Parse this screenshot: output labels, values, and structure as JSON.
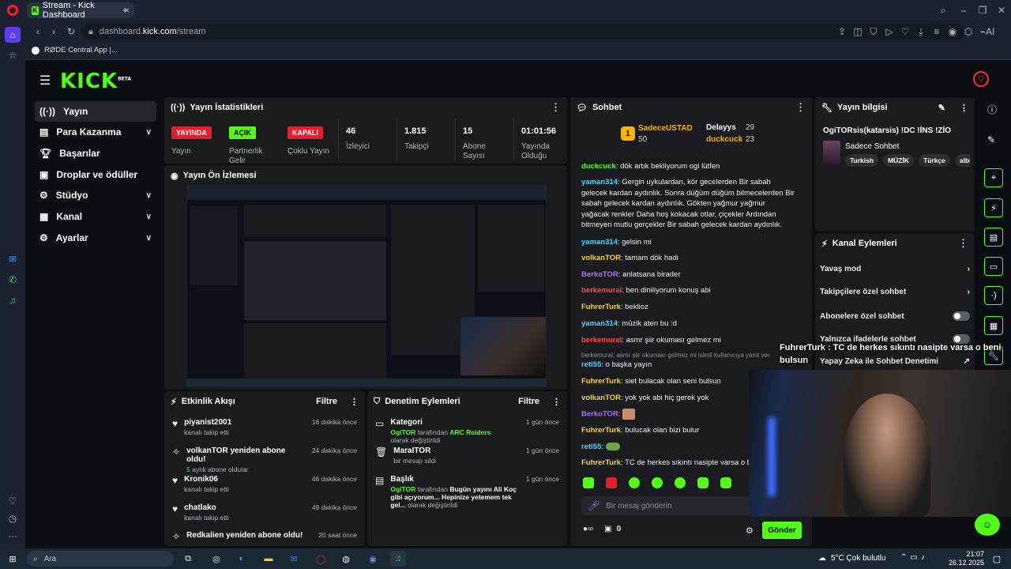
{
  "browser": {
    "tab_title": "Stream - Kick Dashboard",
    "url_prefix": "dashboard.",
    "url_host": "kick.com",
    "url_path": "/stream",
    "bookmark": "RØDE Central App |..."
  },
  "logo": {
    "text": "KICK",
    "beta": "BETA"
  },
  "nav": [
    {
      "label": "Yayın",
      "icon": "broadcast-icon"
    },
    {
      "label": "Para Kazanma",
      "icon": "wallet-icon"
    },
    {
      "label": "Başarılar",
      "icon": "trophy-icon"
    },
    {
      "label": "Droplar ve ödüller",
      "icon": "gift-icon"
    },
    {
      "label": "Stüdyo",
      "icon": "gear-icon"
    },
    {
      "label": "Kanal",
      "icon": "channel-icon"
    },
    {
      "label": "Ayarlar",
      "icon": "settings-icon"
    }
  ],
  "stats": {
    "title": "Yayın İstatistikleri",
    "live_badge": "YAYINDA",
    "live_label": "Yayın",
    "partner_badge": "AÇIK",
    "partner_label": "Partnerlik Gelir",
    "multi_badge": "KAPALI",
    "multi_label": "Çoklu Yayın",
    "viewers_value": "46",
    "viewers_label": "İzleyici",
    "followers_value": "1.815",
    "followers_label": "Takipçi",
    "subs_value": "15",
    "subs_label": "Abone Sayısı",
    "uptime_value": "01:01:56",
    "uptime_label": "Yayında Olduğu"
  },
  "preview": {
    "title": "Yayın Ön İzlemesi"
  },
  "activity": {
    "title": "Etkinlik Akışı",
    "filter": "Filtre",
    "items": [
      {
        "title": "piyanist2001",
        "sub": "kanalı takip etti",
        "time": "16 dakika önce",
        "icon": "heart-icon"
      },
      {
        "title": "volkanTOR yeniden abone oldu!",
        "sub_num": "5",
        "sub": "aylık abone oldular",
        "time": "24 dakika önce",
        "icon": "sparkle-icon"
      },
      {
        "title": "Kronik06",
        "sub": "kanalı takip etti",
        "time": "46 dakika önce",
        "icon": "heart-icon"
      },
      {
        "title": "chatlako",
        "sub": "kanalı takip etti",
        "time": "49 dakika önce",
        "icon": "heart-icon"
      },
      {
        "title": "Redkalien yeniden abone oldu!",
        "sub": "",
        "time": "20 saat önce",
        "icon": "sparkle-icon"
      }
    ]
  },
  "moderation": {
    "title": "Denetim Eylemleri",
    "filter": "Filtre",
    "items": [
      {
        "title": "Kategori",
        "user": "OgiTOR",
        "mid": "tarafından",
        "value": "ARC Raiders",
        "tail": "olarak değiştirildi",
        "time": "1 gün önce"
      },
      {
        "title": "MaraITOR",
        "user": "",
        "mid": "bir mesajı sildi",
        "value": "",
        "tail": "",
        "time": "1 gün önce"
      },
      {
        "title": "Başlık",
        "user": "OgiTOR",
        "mid": "tarafından",
        "value": "Bugün yayını Ali Koç gibi açıyorum... Hepinize yetemem tek gel...",
        "tail": "olarak değiştirildi",
        "time": "1 gün önce"
      }
    ]
  },
  "chat": {
    "title": "Sohbet",
    "top1_name": "SadeceUSTAD",
    "top1_score": "50",
    "top2_name": "Delayys",
    "top2_score": "29",
    "top3_name": "duckcuck",
    "top3_score": "23",
    "messages": [
      {
        "user": "duckcuck",
        "cls": "u-g",
        "text": "dök artık bekliyorum ogi lütfen"
      },
      {
        "user": "yaman314",
        "cls": "u-c",
        "text": "Gergin uykulardan, kör gecelerden Bir sabah gelecek kardan aydınlık. Sonra düğüm düğüm bilmecelerden Bir sabah gelecek kardan aydınlık. Gökten yağmur yağmur yağacak renkler Daha hoş kokacak otlar, çiçekler Ardından bitmeyen mutlu gerçekler Bir sabah gelecek kardan aydınlık."
      },
      {
        "user": "yaman314",
        "cls": "u-c",
        "text": "gelsin mi"
      },
      {
        "user": "volkanTOR",
        "cls": "u-y",
        "text": "tamam dök hadi"
      },
      {
        "user": "BerkoTOR",
        "cls": "u-p",
        "text": "anlatsana birader"
      },
      {
        "user": "berkemural",
        "cls": "u-r",
        "text": "ben diniliyorum konuş abi"
      },
      {
        "user": "FuhrerTurk",
        "cls": "u-y",
        "text": "beklioz"
      },
      {
        "user": "yaman314",
        "cls": "u-c",
        "text": "müzik aten bu :d"
      },
      {
        "user": "berkemural",
        "cls": "u-r",
        "text": "asmr şiir okuması gelmez mi"
      },
      {
        "user": "reti55",
        "cls": "u-c",
        "text": "o başka yayın"
      },
      {
        "user": "FuhrerTurk",
        "cls": "u-y",
        "text": "siet bulacak olan seni bulsun"
      },
      {
        "user": "volkanTOR",
        "cls": "u-y",
        "text": "yok yok abi hiç gerek yok"
      },
      {
        "user": "BerkoTOR",
        "cls": "u-p",
        "text": ""
      },
      {
        "user": "FuhrerTurk",
        "cls": "u-y",
        "text": "bulucak olan bizi bulur"
      },
      {
        "user": "reti55",
        "cls": "u-c",
        "text": ""
      },
      {
        "user": "FuhrerTurk",
        "cls": "u-y",
        "text": "TC de herkes sıkıntı nasipte varsa o ber"
      }
    ],
    "reply_hint": "berkemural: asmr şiir okuması gelmez mi isimli kullanıcıya yanıt ver",
    "input_placeholder": "Bir mesaj gönderin",
    "points": "0",
    "send": "Gönder"
  },
  "info": {
    "title": "Yayın bilgisi",
    "stream_title": "OgiTORsis(katarsis) !DC !İNS !ZİO",
    "category": "Sadece Sohbet",
    "tags": [
      "Turkish",
      "MÜZİK",
      "Türkçe",
      "albio"
    ]
  },
  "channel_actions": {
    "title": "Kanal Eylemleri",
    "slow_mode": "Yavaş mod",
    "followers_only": "Takipçilere özel sohbet",
    "subs_only": "Abonelere özel sohbet",
    "emotes_only": "Yalnızca ifadelerle sohbet",
    "ai_moderation": "Yapay Zeka ile Sohbet Denetimi"
  },
  "overlay": {
    "user": "FuhrerTurk",
    "text": "TC de herkes sıkıntı nasipte varsa o beni bulsun"
  },
  "taskbar": {
    "search": "Ara",
    "weather": "5°C  Çok bulutlu",
    "time": "21:07",
    "date": "26.12.2025"
  },
  "colors": {
    "accent": "#53fc18",
    "live": "#e0202e",
    "panel": "#191b1f"
  }
}
